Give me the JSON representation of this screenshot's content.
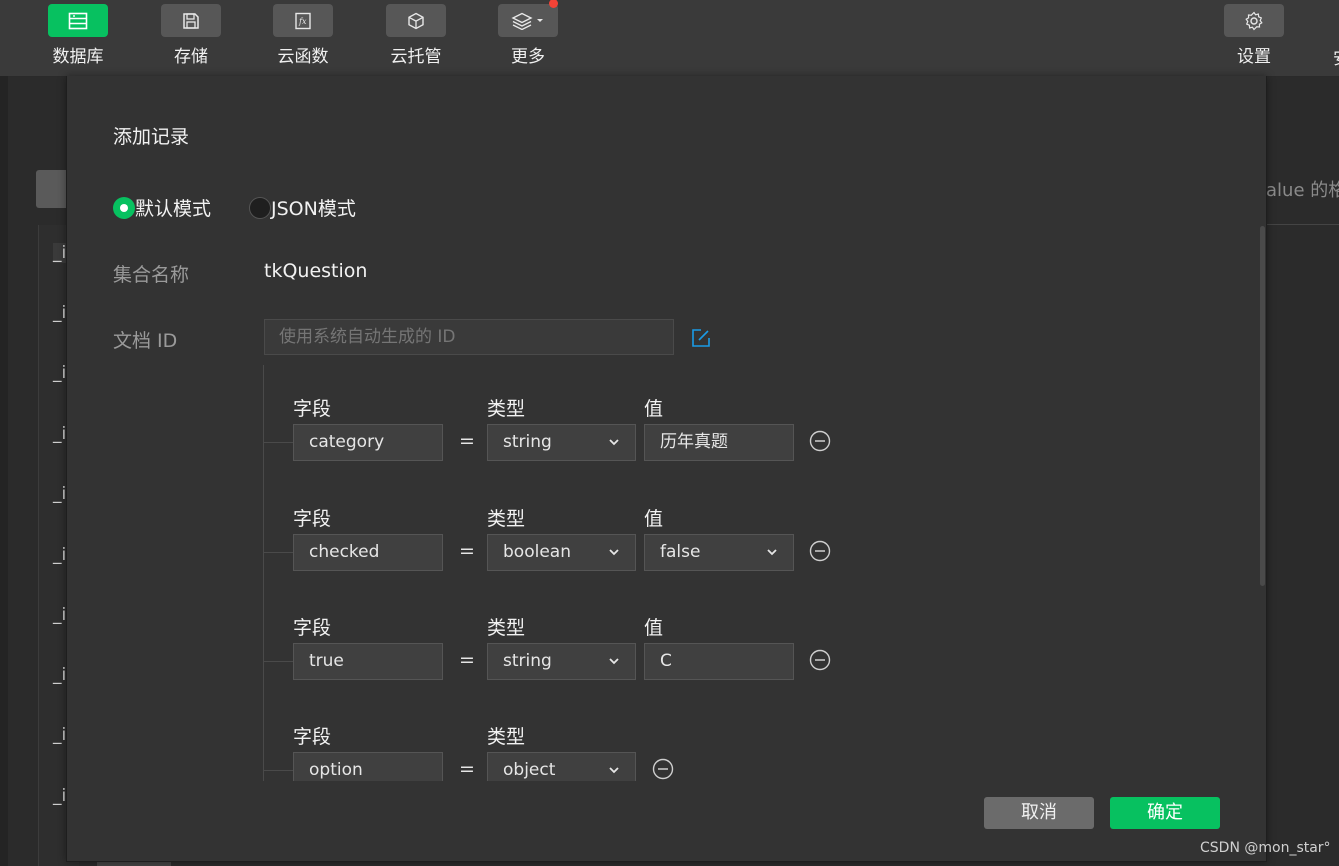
{
  "toolbar": {
    "items": [
      {
        "label": "数据库",
        "icon": "database-icon",
        "active": true
      },
      {
        "label": "存储",
        "icon": "save-icon"
      },
      {
        "label": "云函数",
        "icon": "function-icon"
      },
      {
        "label": "云托管",
        "icon": "cube-icon"
      },
      {
        "label": "更多",
        "icon": "layers-icon"
      }
    ],
    "settings_label": "设置",
    "edge_char": "安"
  },
  "background": {
    "list_items": [
      "_i",
      "_i",
      "_i",
      "_i",
      "_i",
      "_i",
      "_i",
      "_i",
      "_i",
      "_i"
    ],
    "search_placeholder": "alue 的格"
  },
  "dialog": {
    "title": "添加记录",
    "modes": [
      "默认模式",
      "JSON模式"
    ],
    "selected_mode": "默认模式",
    "collection_label": "集合名称",
    "collection_value": "tkQuestion",
    "doc_id_label": "文档 ID",
    "doc_id_placeholder": "使用系统自动生成的 ID",
    "field_header": "字段",
    "type_header": "类型",
    "value_header": "值",
    "equals": "=",
    "fields": [
      {
        "name": "category",
        "type": "string",
        "value": "历年真题",
        "value_kind": "text"
      },
      {
        "name": "checked",
        "type": "boolean",
        "value": "false",
        "value_kind": "select"
      },
      {
        "name": "true",
        "type": "string",
        "value": "C",
        "value_kind": "text"
      },
      {
        "name": "option",
        "type": "object",
        "value": "",
        "value_kind": "none"
      }
    ],
    "cancel_label": "取消",
    "confirm_label": "确定"
  },
  "watermark": "CSDN @mon_star°",
  "colors": {
    "accent": "#07c160",
    "link_blue": "#1a9be6",
    "notification": "#f44336"
  }
}
